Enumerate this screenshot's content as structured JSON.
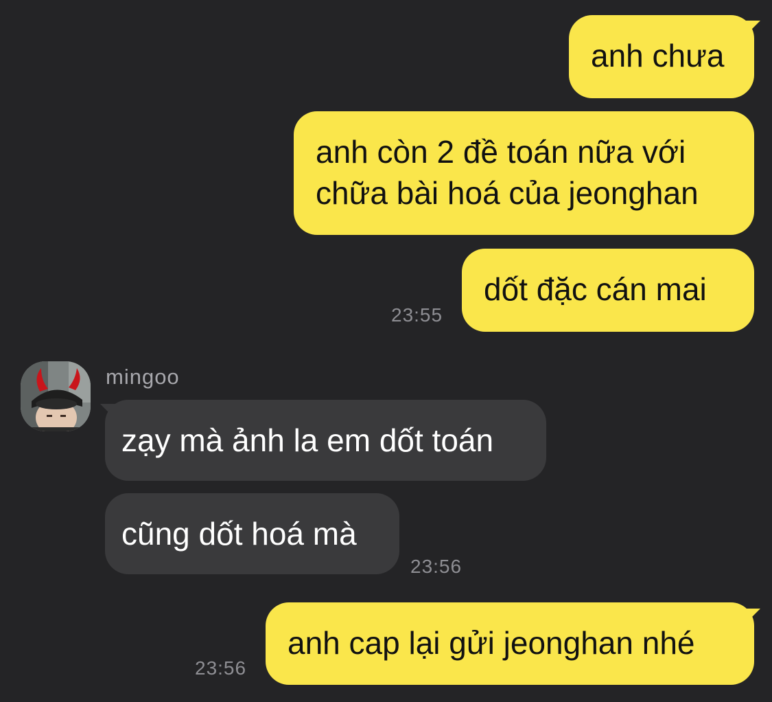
{
  "conversation": {
    "outgoing_1": {
      "lines": [
        "anh chưa"
      ]
    },
    "outgoing_2": {
      "lines": [
        "anh còn 2 đề toán nữa với",
        "chữa bài hoá của jeonghan"
      ]
    },
    "outgoing_3": {
      "lines": [
        "dốt đặc cán mai"
      ],
      "time": "23:55"
    },
    "incoming": {
      "sender": "mingoo",
      "avatar_icon": "avatar-with-devil-horns",
      "messages": [
        {
          "text": "zạy mà ảnh la em dốt toán"
        },
        {
          "text": "cũng dốt hoá mà",
          "time": "23:56"
        }
      ]
    },
    "outgoing_4": {
      "lines": [
        "anh cap lại gửi jeonghan nhé"
      ],
      "time": "23:56"
    }
  },
  "colors": {
    "background": "#242426",
    "outgoing_bubble": "#FAE64B",
    "incoming_bubble": "#3A3A3C",
    "timestamp": "#8E8E93"
  }
}
